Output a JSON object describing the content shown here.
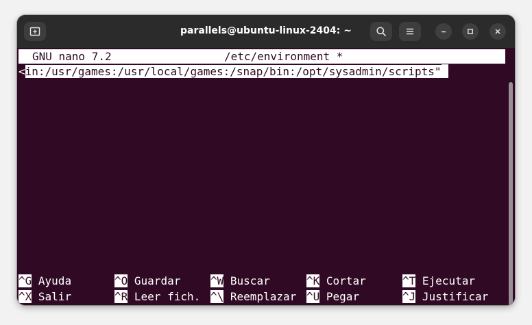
{
  "window": {
    "title": "parallels@ubuntu-linux-2404: ~"
  },
  "nano": {
    "version": "GNU nano 7.2",
    "filename": "/etc/environment *",
    "edit_line_marker": "<",
    "edit_line_text": "in:/usr/games:/usr/local/games:/snap/bin:/opt/sysadmin/scripts\""
  },
  "shortcuts": {
    "row1": [
      {
        "key": "^G",
        "label": "Ayuda"
      },
      {
        "key": "^O",
        "label": "Guardar"
      },
      {
        "key": "^W",
        "label": "Buscar"
      },
      {
        "key": "^K",
        "label": "Cortar"
      },
      {
        "key": "^T",
        "label": "Ejecutar"
      }
    ],
    "row2": [
      {
        "key": "^X",
        "label": "Salir"
      },
      {
        "key": "^R",
        "label": "Leer fich."
      },
      {
        "key": "^\\",
        "label": "Reemplazar"
      },
      {
        "key": "^U",
        "label": "Pegar"
      },
      {
        "key": "^J",
        "label": "Justificar"
      }
    ]
  },
  "colors": {
    "terminal_bg": "#300a24",
    "text": "#ffffff"
  }
}
